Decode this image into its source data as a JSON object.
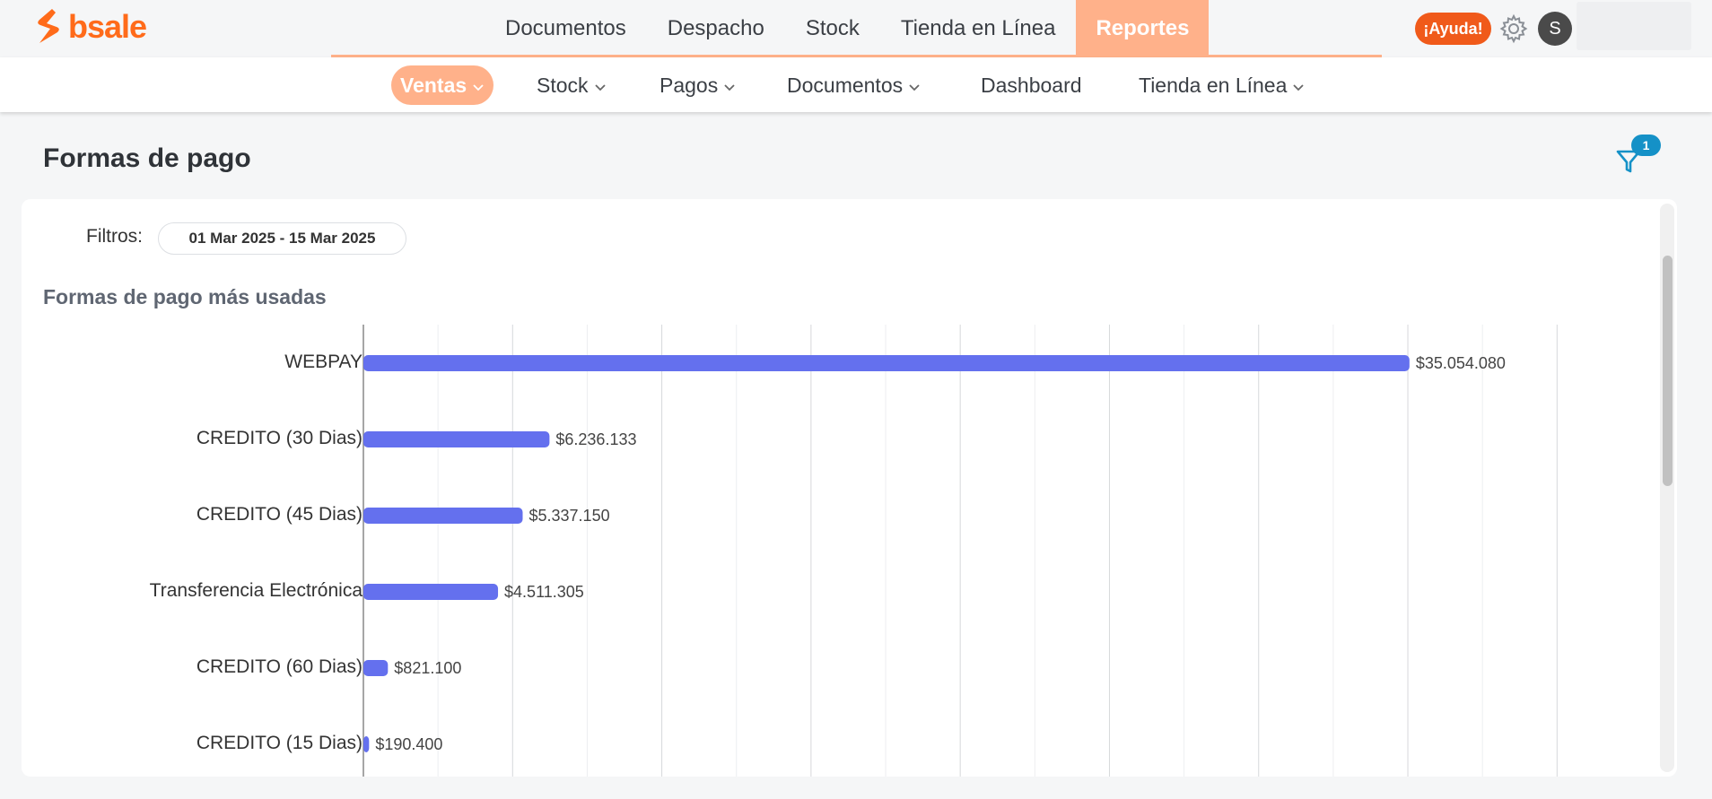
{
  "app": {
    "logo_text": "bsale",
    "brand_color": "#ff6b1a",
    "accent_color": "#ffb18a"
  },
  "main_nav": [
    {
      "label": "Documentos",
      "active": false
    },
    {
      "label": "Despacho",
      "active": false
    },
    {
      "label": "Stock",
      "active": false
    },
    {
      "label": "Tienda en Línea",
      "active": false
    },
    {
      "label": "Reportes",
      "active": true
    }
  ],
  "header_actions": {
    "help_label": "¡Ayuda!",
    "settings_icon": "gear-icon",
    "avatar_initial": "S"
  },
  "sub_nav": [
    {
      "label": "Ventas",
      "dropdown": true,
      "active": true
    },
    {
      "label": "Stock",
      "dropdown": true,
      "active": false
    },
    {
      "label": "Pagos",
      "dropdown": true,
      "active": false
    },
    {
      "label": "Documentos",
      "dropdown": true,
      "active": false
    },
    {
      "label": "Dashboard",
      "dropdown": false,
      "active": false
    },
    {
      "label": "Tienda en Línea",
      "dropdown": true,
      "active": false
    }
  ],
  "page": {
    "title": "Formas de pago",
    "filter_icon": "filter-icon",
    "filter_badge": "1",
    "filters_label": "Filtros:",
    "date_filter": "01 Mar 2025 - 15 Mar 2025",
    "section_title": "Formas de pago más usadas"
  },
  "chart_data": {
    "type": "bar",
    "orientation": "horizontal",
    "categories": [
      "WEBPAY",
      "CREDITO (30 Dias)",
      "CREDITO (45 Dias)",
      "Transferencia Electrónica",
      "CREDITO (60 Dias)",
      "CREDITO (15 Dias)"
    ],
    "values": [
      35054080,
      6236133,
      5337150,
      4511305,
      821100,
      190400
    ],
    "value_labels": [
      "$35.054.080",
      "$6.236.133",
      "$5.337.150",
      "$4.511.305",
      "$821.100",
      "$190.400"
    ],
    "xlim": [
      0,
      40000000
    ],
    "bar_color": "#6470ee",
    "grid": true
  }
}
